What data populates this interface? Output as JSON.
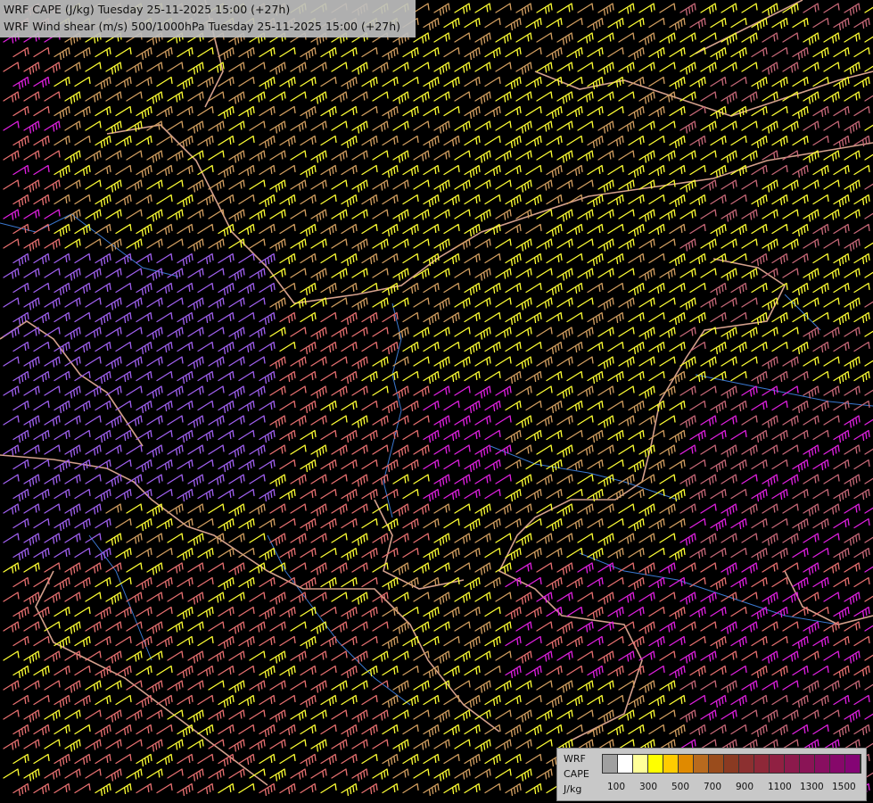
{
  "title": {
    "line1": "WRF CAPE (J/kg) Tuesday 25-11-2025 15:00 (+27h)",
    "line2": "WRF Wind shear (m/s) 500/1000hPa Tuesday 25-11-2025 15:00 (+27h)"
  },
  "legend": {
    "label1": "WRF",
    "label2": "CAPE",
    "label3": "J/kg",
    "colors": [
      "#a0a0a0",
      "#ffffff",
      "#ffff99",
      "#ffff00",
      "#ffcc00",
      "#e08a00",
      "#b86a1e",
      "#9a4c1c",
      "#8a3a22",
      "#8c3030",
      "#8e2838",
      "#902042",
      "#8c1a4c",
      "#8a1456",
      "#880e60",
      "#86086a",
      "#840474"
    ],
    "ticks": [
      "100",
      "300",
      "500",
      "700",
      "900",
      "1100",
      "1300",
      "1500"
    ]
  },
  "barb_colors": {
    "yellow": "#ffff33",
    "tan": "#d4a060",
    "salmon": "#e87070",
    "magenta": "#e020e0",
    "violet": "#a060f0",
    "rose": "#c86878"
  },
  "line_colors": {
    "border": "#d4a08c",
    "river": "#3a78d0"
  }
}
